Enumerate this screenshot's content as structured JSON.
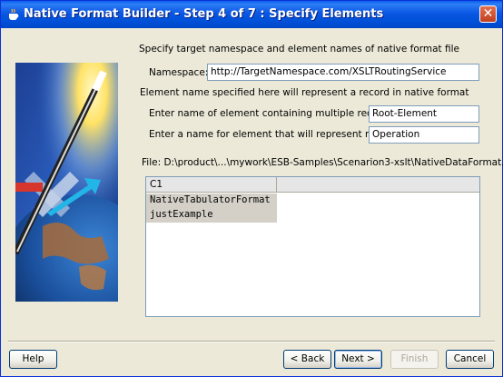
{
  "window": {
    "title": "Native Format Builder - Step 4 of 7 : Specify Elements"
  },
  "form": {
    "intro": "Specify target namespace and element names of native format file",
    "namespace_label": "Namespace:",
    "namespace_value": "http://TargetNamespace.com/XSLTRoutingService",
    "record_note": "Element name specified here will represent a record in native format",
    "multi_label": "Enter name of element containing multiple records:",
    "multi_value": "Root-Element",
    "record_label": "Enter a name for element that will represent record:",
    "record_value": "Operation",
    "file_text": "File: D:\\product\\...\\mywork\\ESB-Samples\\Scenarion3-xslt\\NativeDataFormat.txt"
  },
  "table": {
    "column": "C1",
    "rows": [
      "NativeTabulatorFormat",
      "justExample"
    ]
  },
  "buttons": {
    "help": "Help",
    "back": "< Back",
    "next": "Next >",
    "finish": "Finish",
    "cancel": "Cancel"
  }
}
